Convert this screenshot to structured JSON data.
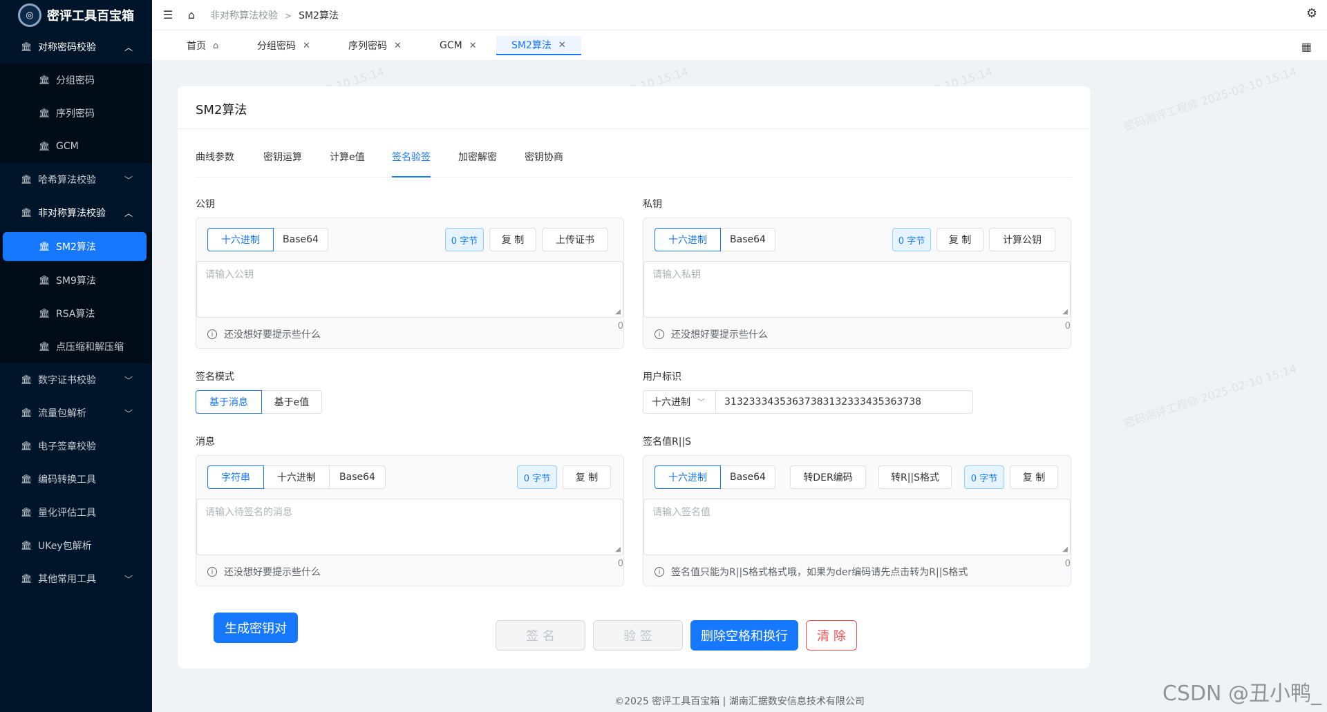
{
  "app": {
    "logo_text": "密评工具百宝箱",
    "logo_mark": "◎"
  },
  "sidebar": {
    "groups": [
      {
        "label": "对称密码校验",
        "items": [
          "分组密码",
          "序列密码",
          "GCM"
        ]
      },
      {
        "label": "哈希算法校验"
      },
      {
        "label": "非对称算法校验",
        "items": [
          "SM2算法",
          "SM9算法",
          "RSA算法",
          "点压缩和解压缩"
        ]
      },
      {
        "label": "数字证书校验"
      },
      {
        "label": "流量包解析"
      },
      {
        "label": "电子签章校验"
      },
      {
        "label": "编码转换工具"
      },
      {
        "label": "量化评估工具"
      },
      {
        "label": "UKey包解析"
      },
      {
        "label": "其他常用工具"
      }
    ]
  },
  "breadcrumb": {
    "parent": "非对称算法校验",
    "sep": ">",
    "current": "SM2算法"
  },
  "page_tabs": [
    {
      "label": "首页"
    },
    {
      "label": "分组密码"
    },
    {
      "label": "序列密码"
    },
    {
      "label": "GCM"
    },
    {
      "label": "SM2算法"
    }
  ],
  "card": {
    "title": "SM2算法"
  },
  "sub_tabs": [
    "曲线参数",
    "密钥运算",
    "计算e值",
    "签名验签",
    "加密解密",
    "密钥协商"
  ],
  "common": {
    "hex": "十六进制",
    "base64": "Base64",
    "bytes": "0 字节",
    "copy": "复 制",
    "count": "0",
    "hint": "还没想好要提示些什么",
    "info": "i",
    "grip": "◢"
  },
  "public_key": {
    "label": "公钥",
    "upload": "上传证书",
    "placeholder": "请输入公钥"
  },
  "private_key": {
    "label": "私钥",
    "calc_pub": "计算公钥",
    "placeholder": "请输入私钥"
  },
  "sign_mode": {
    "label": "签名模式",
    "opt1": "基于消息",
    "opt2": "基于e值"
  },
  "user_id": {
    "label": "用户标识",
    "encoding": "十六进制",
    "value": "31323334353637383132333435363738"
  },
  "message": {
    "label": "消息",
    "opt_str": "字符串",
    "placeholder": "请输入待签名的消息"
  },
  "signature": {
    "label": "签名值R||S",
    "to_der": "转DER编码",
    "to_rs": "转R||S格式",
    "placeholder": "请输入签名值",
    "hint": "签名值只能为R||S格式格式哦，如果为der编码请先点击转为R||S格式"
  },
  "actions": {
    "gen": "生成密钥对",
    "sign": "签 名",
    "verify": "验 签",
    "strip": "删除空格和换行",
    "clear": "清 除"
  },
  "footer": "©2025 密评工具百宝箱 | 湖南汇据数安信息技术有限公司",
  "watermark": "密码测评工程师 2025-02-10 15:14",
  "csdn": "CSDN @丑小鸭_"
}
